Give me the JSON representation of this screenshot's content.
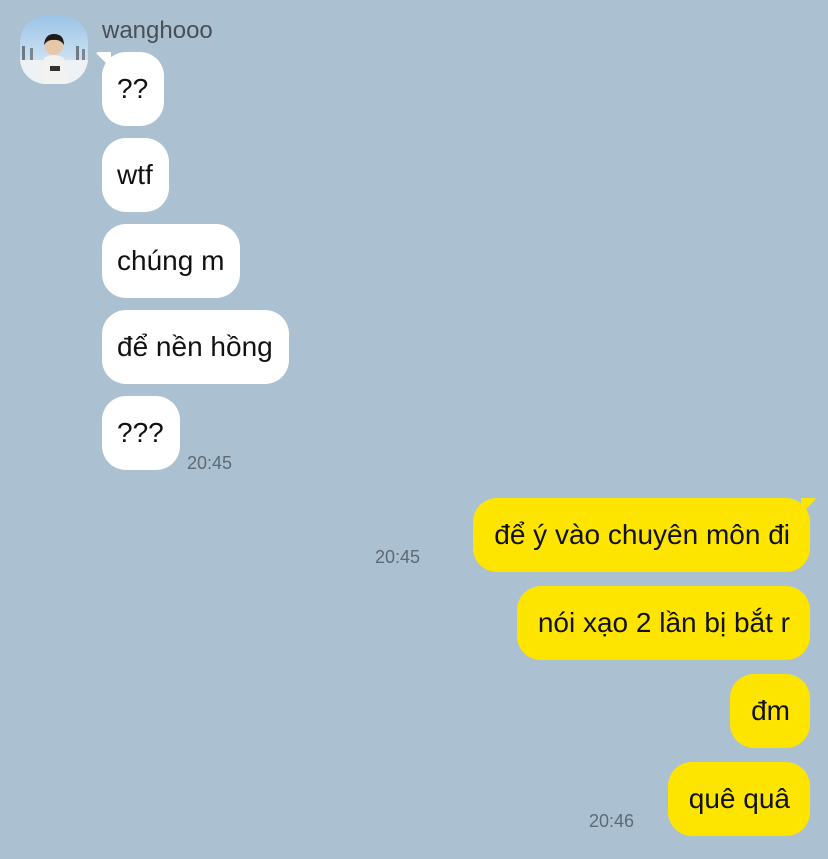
{
  "chat": {
    "sender_name": "wanghooo",
    "incoming": [
      "??",
      "wtf",
      "chúng m",
      "để nền hồng",
      "???"
    ],
    "incoming_time": "20:45",
    "outgoing": [
      "để ý vào chuyên môn đi",
      "nói xạo 2 lần bị bắt r",
      "đm",
      "quê quâ"
    ],
    "outgoing_time_1": "20:45",
    "outgoing_time_2": "20:46"
  },
  "colors": {
    "background": "#abc1d1",
    "incoming_bubble": "#ffffff",
    "outgoing_bubble": "#fee500",
    "timestamp": "#5e6a74"
  },
  "icons": {
    "avatar": "profile-photo-avatar"
  }
}
